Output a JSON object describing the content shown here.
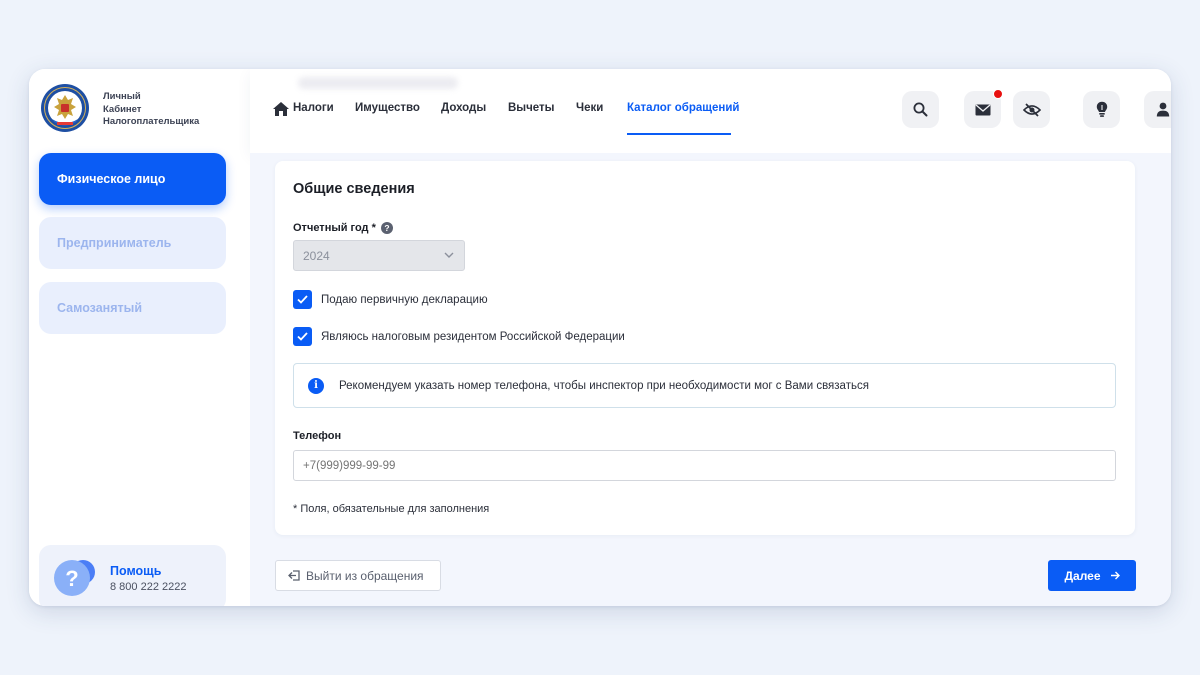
{
  "sidebar": {
    "logo_text": "Личный\nКабинет\nНалогоплательщика",
    "logo_ring_text": "ФЕДЕРАЛЬНАЯ НАЛОГОВАЯ СЛУЖБА",
    "items": [
      {
        "label": "Физическое лицо",
        "active": true
      },
      {
        "label": "Предприниматель",
        "active": false
      },
      {
        "label": "Самозанятый",
        "active": false
      }
    ],
    "help": {
      "title": "Помощь",
      "phone": "8 800 222 2222"
    }
  },
  "nav": {
    "items": [
      "Налоги",
      "Имущество",
      "Доходы",
      "Вычеты",
      "Чеки",
      "Каталог обращений"
    ],
    "active": "Каталог обращений",
    "icons": [
      "home-icon",
      "search-icon",
      "mail-icon",
      "hidden-eye-icon",
      "lightbulb-icon",
      "user-icon"
    ],
    "notification": true
  },
  "form": {
    "title": "Общие сведения",
    "year_label": "Отчетный год *",
    "year_value": "2024",
    "checkboxes": [
      {
        "label": "Подаю первичную декларацию",
        "checked": true
      },
      {
        "label": "Являюсь налоговым резидентом Российской Федерации",
        "checked": true
      }
    ],
    "info_text": "Рекомендуем указать номер телефона, чтобы инспектор при необходимости мог с Вами связаться",
    "phone_label": "Телефон",
    "phone_placeholder": "+7(999)999-99-99",
    "required_note": "* Поля, обязательные для заполнения"
  },
  "actions": {
    "exit_label": "Выйти из обращения",
    "next_label": "Далее"
  },
  "colors": {
    "accent": "#0a5cf5",
    "notification": "#e8100f",
    "background": "#eef3fb"
  }
}
